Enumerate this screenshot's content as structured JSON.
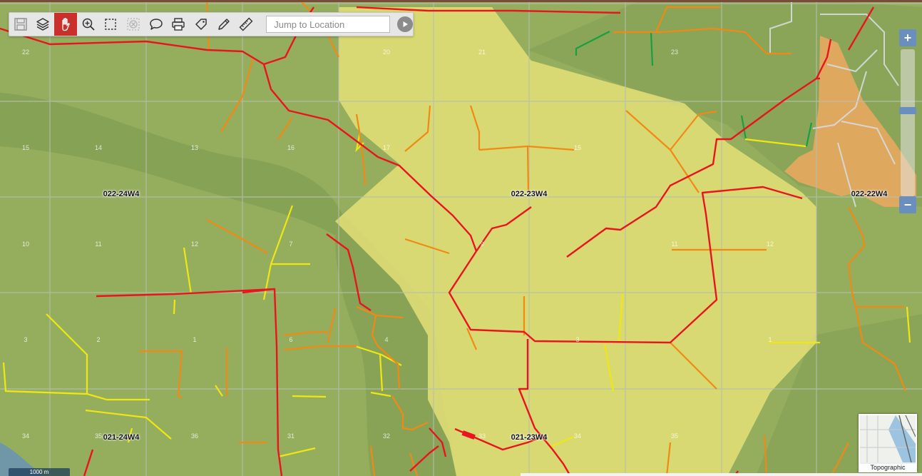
{
  "toolbar": {
    "tools": [
      {
        "name": "save-icon",
        "tooltip": "Save"
      },
      {
        "name": "layers-icon",
        "tooltip": "Layers"
      },
      {
        "name": "pan-hand-icon",
        "tooltip": "Pan",
        "active": true
      },
      {
        "name": "zoom-in-icon",
        "tooltip": "Zoom In"
      },
      {
        "name": "select-box-icon",
        "tooltip": "Select"
      },
      {
        "name": "clear-selection-icon",
        "tooltip": "Clear",
        "disabled": true
      },
      {
        "name": "comment-icon",
        "tooltip": "Comment"
      },
      {
        "name": "print-icon",
        "tooltip": "Print"
      },
      {
        "name": "tag-icon",
        "tooltip": "Tag"
      },
      {
        "name": "pencil-icon",
        "tooltip": "Draw"
      },
      {
        "name": "ruler-icon",
        "tooltip": "Measure"
      }
    ],
    "jump_placeholder": "Jump to Location",
    "go_icon": "play-circle-icon"
  },
  "zoom": {
    "plus": "+",
    "minus": "−"
  },
  "townships": [
    {
      "label": "022-24W4"
    },
    {
      "label": "022-23W4"
    },
    {
      "label": "022-22W4"
    },
    {
      "label": "021-24W4"
    },
    {
      "label": "021-23W4"
    }
  ],
  "sections": [
    "22",
    "20",
    "21",
    "23",
    "15",
    "14",
    "13",
    "16",
    "17",
    "15",
    "10",
    "11",
    "12",
    "7",
    "9",
    "11",
    "12",
    "3",
    "2",
    "1",
    "6",
    "4",
    "3",
    "1",
    "34",
    "35",
    "36",
    "31",
    "32",
    "33",
    "34",
    "35"
  ],
  "basemap": {
    "label": "Topographic"
  },
  "scale": {
    "label": "1000 m"
  },
  "colors": {
    "background": "#8fa85a",
    "highlight_zone": "#e9e479",
    "urban": "#f0a860",
    "pipeline_red": "#e8141e",
    "pipeline_orange": "#f08a14",
    "pipeline_yellow": "#f0e614",
    "pipeline_green": "#18a040",
    "toolbar_active": "#c9302c",
    "zoom_blue": "#6a8fbf"
  }
}
